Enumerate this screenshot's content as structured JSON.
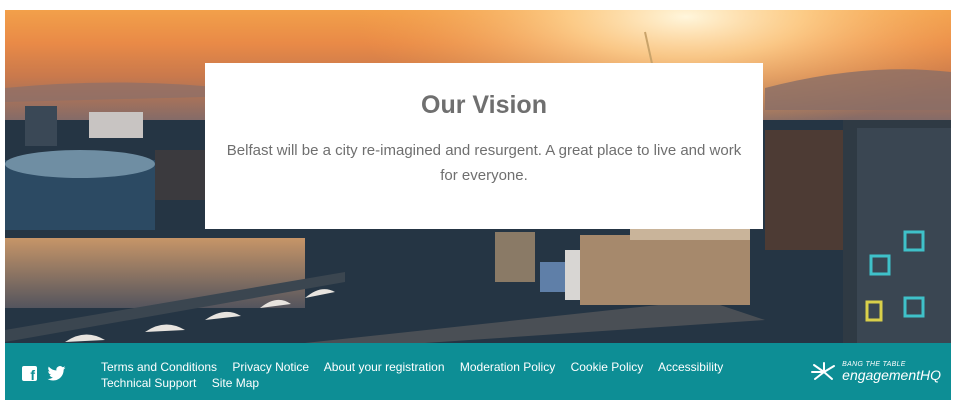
{
  "hero": {
    "image_alt": "Belfast city skyline at sunset"
  },
  "vision": {
    "title": "Our Vision",
    "body": "Belfast will be a city re-imagined and resurgent.  A great place to live and work for everyone."
  },
  "footer": {
    "social": [
      "facebook-icon",
      "twitter-icon"
    ],
    "links": [
      "Terms and Conditions",
      "Privacy Notice",
      "About your registration",
      "Moderation Policy",
      "Cookie Policy",
      "Accessibility",
      "Technical Support",
      "Site Map"
    ],
    "brand": {
      "tagline": "BANG THE TABLE",
      "name": "engagementHQ"
    }
  },
  "colors": {
    "footer_bg": "#0d8e95",
    "heading_text": "#6f6f6f"
  }
}
